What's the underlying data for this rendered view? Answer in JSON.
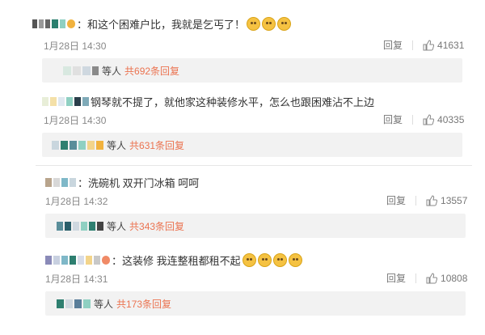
{
  "comments": [
    {
      "text": "：和这个困难户比，我就是乞丐了！",
      "time": "1月28日 14:30",
      "reply_label": "回复",
      "likes": "41631",
      "reply_summary_prefix": "等人",
      "reply_summary_link": "共692条回复"
    },
    {
      "text": "钢琴就不提了，就他家这种装修水平，怎么也跟困难沾不上边",
      "time": "1月28日 14:30",
      "reply_label": "回复",
      "likes": "40335",
      "reply_summary_prefix": "等人",
      "reply_summary_link": "共631条回复"
    },
    {
      "text": "：洗碗机 双开门冰箱 呵呵",
      "time": "1月28日 14:32",
      "reply_label": "回复",
      "likes": "13557",
      "reply_summary_prefix": "等人",
      "reply_summary_link": "共343条回复"
    },
    {
      "text": "：这装修 我连整租都租不起",
      "time": "1月28日 14:31",
      "reply_label": "回复",
      "likes": "10808",
      "reply_summary_prefix": "等人",
      "reply_summary_link": "共173条回复"
    }
  ],
  "icons": {
    "like": "thumbs-up-icon",
    "emoji": "crying-laugh-emoji-icon"
  },
  "colors": {
    "link": "#eb7350",
    "reply_bg": "#f2f2f2",
    "meta": "#888888"
  }
}
